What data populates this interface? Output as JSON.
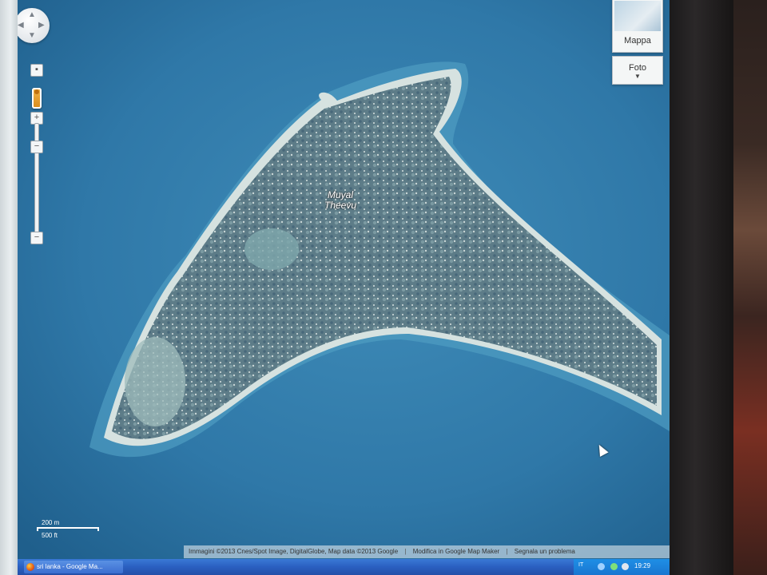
{
  "map": {
    "place_label_line1": "Muyal",
    "place_label_line2": "Theevu",
    "map_type_label": "Mappa",
    "satellite_label": "Foto",
    "scale_metric": "200 m",
    "scale_imperial": "500 ft",
    "attribution": "Immagini ©2013 Cnes/Spot Image, DigitalGlobe, Map data ©2013 Google",
    "edit_link": "Modifica in Google Map Maker",
    "report_link": "Segnala un problema"
  },
  "taskbar": {
    "task_label": "sri lanka - Google Ma...",
    "language": "IT",
    "clock": "19:29"
  },
  "colors": {
    "sea": "#2f78a8",
    "shallow": "#5aa5c6",
    "beach": "#d9e4e2",
    "land": "#5f7f8a"
  }
}
